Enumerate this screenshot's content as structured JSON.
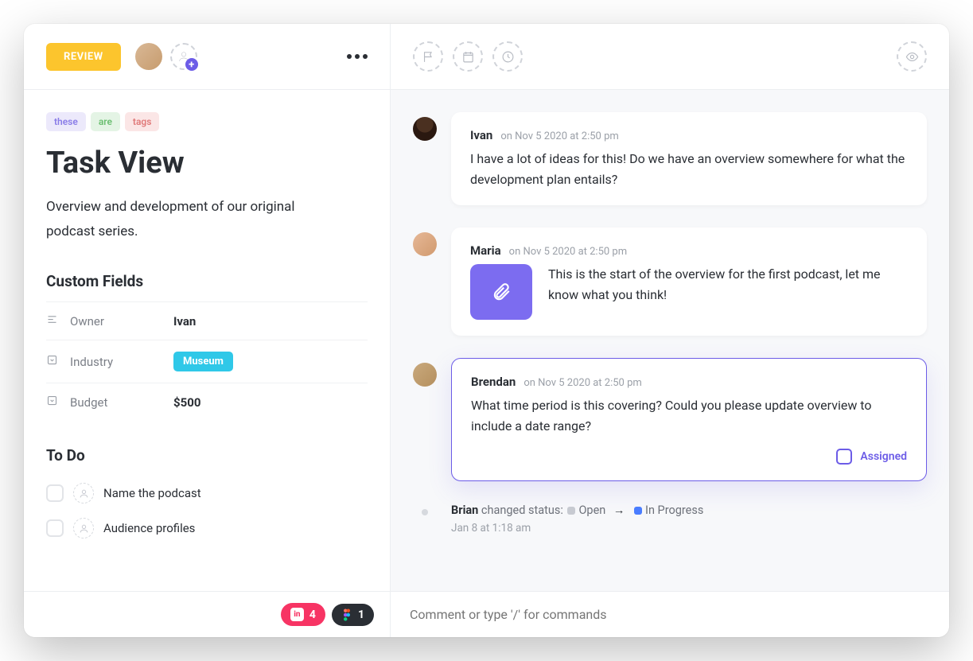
{
  "header": {
    "status": "REVIEW"
  },
  "task": {
    "tags": [
      "these",
      "are",
      "tags"
    ],
    "title": "Task View",
    "description": "Overview and development of our original podcast series."
  },
  "customFields": {
    "heading": "Custom Fields",
    "owner": {
      "label": "Owner",
      "value": "Ivan"
    },
    "industry": {
      "label": "Industry",
      "value": "Museum"
    },
    "budget": {
      "label": "Budget",
      "value": "$500"
    }
  },
  "todo": {
    "heading": "To Do",
    "items": [
      "Name the podcast",
      "Audience profiles"
    ]
  },
  "comments": [
    {
      "author": "Ivan",
      "time": "on Nov 5 2020 at 2:50 pm",
      "body": "I have a lot of ideas for this! Do we have an overview somewhere for what the development plan entails?"
    },
    {
      "author": "Maria",
      "time": "on Nov 5 2020 at 2:50 pm",
      "body": "This is the start of the overview for the first podcast, let me know what you think!"
    },
    {
      "author": "Brendan",
      "time": "on Nov 5 2020 at 2:50 pm",
      "body": "What time period is this covering? Could you please update overview to include a date range?",
      "assigned_label": "Assigned"
    }
  ],
  "activity": {
    "actor": "Brian",
    "verb": "changed status:",
    "from": "Open",
    "to": "In Progress",
    "time": "Jan 8 at 1:18 am"
  },
  "footer": {
    "invision_count": "4",
    "figma_count": "1",
    "comment_placeholder": "Comment or type '/' for commands"
  }
}
